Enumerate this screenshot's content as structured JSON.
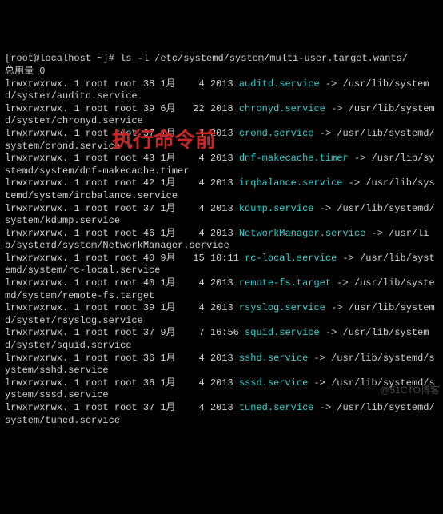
{
  "prompt": {
    "user": "root",
    "host": "localhost",
    "cwd": "~",
    "symbol": "#",
    "command": "ls -l /etc/systemd/system/multi-user.target.wants/"
  },
  "total_line": "总用量 0",
  "entries": [
    {
      "perm": "lrwxrwxrwx.",
      "n": "1",
      "own": "root root",
      "size": "38",
      "month": "1月",
      "day": "   4",
      "time": "2013",
      "name": "auditd.service",
      "rest": " -> /usr/lib/systemd/system/auditd.service"
    },
    {
      "perm": "lrwxrwxrwx.",
      "n": "1",
      "own": "root root",
      "size": "39",
      "month": "6月",
      "day": "  22",
      "time": "2018",
      "name": "chronyd.service",
      "rest": " -> /usr/lib/systemd/system/chronyd.service"
    },
    {
      "perm": "lrwxrwxrwx.",
      "n": "1",
      "own": "root root",
      "size": "37",
      "month": "1月",
      "day": "   4",
      "time": "2013",
      "name": "crond.service",
      "rest": " -> /usr/lib/systemd/system/crond.service"
    },
    {
      "perm": "lrwxrwxrwx.",
      "n": "1",
      "own": "root root",
      "size": "43",
      "month": "1月",
      "day": "   4",
      "time": "2013",
      "name": "dnf-makecache.timer",
      "rest": " -> /usr/lib/systemd/system/dnf-makecache.timer"
    },
    {
      "perm": "lrwxrwxrwx.",
      "n": "1",
      "own": "root root",
      "size": "42",
      "month": "1月",
      "day": "   4",
      "time": "2013",
      "name": "irqbalance.service",
      "rest": " -> /usr/lib/systemd/system/irqbalance.service"
    },
    {
      "perm": "lrwxrwxrwx.",
      "n": "1",
      "own": "root root",
      "size": "37",
      "month": "1月",
      "day": "   4",
      "time": "2013",
      "name": "kdump.service",
      "rest": " -> /usr/lib/systemd/system/kdump.service"
    },
    {
      "perm": "lrwxrwxrwx.",
      "n": "1",
      "own": "root root",
      "size": "46",
      "month": "1月",
      "day": "   4",
      "time": "2013",
      "name": "NetworkManager.service",
      "rest": " -> /usr/lib/systemd/system/NetworkManager.service"
    },
    {
      "perm": "lrwxrwxrwx.",
      "n": "1",
      "own": "root root",
      "size": "40",
      "month": "9月",
      "day": "  15",
      "time": "10:11",
      "name": "rc-local.service",
      "rest": " -> /usr/lib/systemd/system/rc-local.service"
    },
    {
      "perm": "lrwxrwxrwx.",
      "n": "1",
      "own": "root root",
      "size": "40",
      "month": "1月",
      "day": "   4",
      "time": "2013",
      "name": "remote-fs.target",
      "rest": " -> /usr/lib/systemd/system/remote-fs.target"
    },
    {
      "perm": "lrwxrwxrwx.",
      "n": "1",
      "own": "root root",
      "size": "39",
      "month": "1月",
      "day": "   4",
      "time": "2013",
      "name": "rsyslog.service",
      "rest": " -> /usr/lib/systemd/system/rsyslog.service"
    },
    {
      "perm": "lrwxrwxrwx.",
      "n": "1",
      "own": "root root",
      "size": "37",
      "month": "9月",
      "day": "   7",
      "time": "16:56",
      "name": "squid.service",
      "rest": " -> /usr/lib/systemd/system/squid.service"
    },
    {
      "perm": "lrwxrwxrwx.",
      "n": "1",
      "own": "root root",
      "size": "36",
      "month": "1月",
      "day": "   4",
      "time": "2013",
      "name": "sshd.service",
      "rest": " -> /usr/lib/systemd/system/sshd.service"
    },
    {
      "perm": "lrwxrwxrwx.",
      "n": "1",
      "own": "root root",
      "size": "36",
      "month": "1月",
      "day": "   4",
      "time": "2013",
      "name": "sssd.service",
      "rest": " -> /usr/lib/systemd/system/sssd.service"
    },
    {
      "perm": "lrwxrwxrwx.",
      "n": "1",
      "own": "root root",
      "size": "37",
      "month": "1月",
      "day": "   4",
      "time": "2013",
      "name": "tuned.service",
      "rest": " -> /usr/lib/systemd/system/tuned.service"
    }
  ],
  "overlay_text": "执行命令前",
  "watermark_text": "@51CTO博客"
}
